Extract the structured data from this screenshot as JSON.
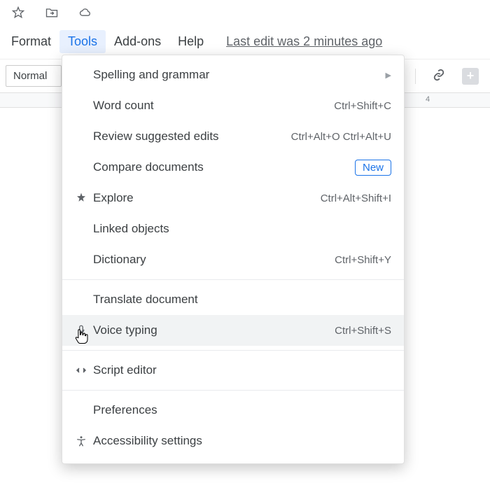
{
  "menubar": {
    "format": "Format",
    "tools": "Tools",
    "addons": "Add-ons",
    "help": "Help",
    "last_edit": "Last edit was 2 minutes ago"
  },
  "toolbar": {
    "style": "Normal"
  },
  "ruler": {
    "mark4": "4"
  },
  "tools_menu": {
    "spelling": {
      "label": "Spelling and grammar"
    },
    "word_count": {
      "label": "Word count",
      "shortcut": "Ctrl+Shift+C"
    },
    "review": {
      "label": "Review suggested edits",
      "shortcut": "Ctrl+Alt+O Ctrl+Alt+U"
    },
    "compare": {
      "label": "Compare documents",
      "badge": "New"
    },
    "explore": {
      "label": "Explore",
      "shortcut": "Ctrl+Alt+Shift+I"
    },
    "linked": {
      "label": "Linked objects"
    },
    "dictionary": {
      "label": "Dictionary",
      "shortcut": "Ctrl+Shift+Y"
    },
    "translate": {
      "label": "Translate document"
    },
    "voice": {
      "label": "Voice typing",
      "shortcut": "Ctrl+Shift+S"
    },
    "script": {
      "label": "Script editor"
    },
    "preferences": {
      "label": "Preferences"
    },
    "accessibility": {
      "label": "Accessibility settings"
    }
  }
}
